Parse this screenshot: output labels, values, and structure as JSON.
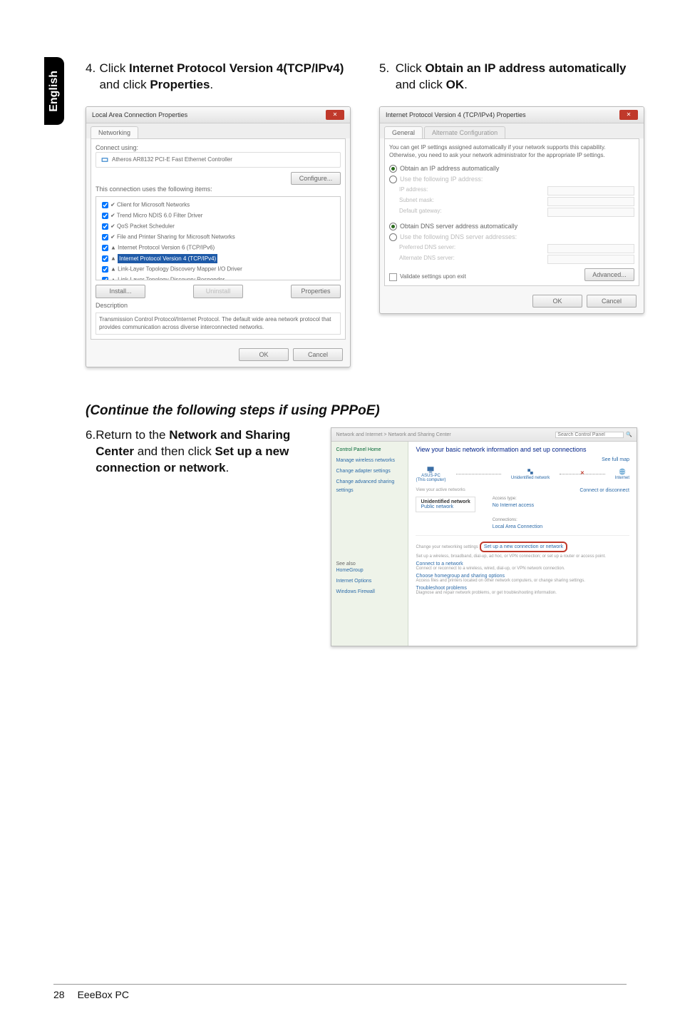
{
  "side_tab": "English",
  "chart_data": null,
  "step4": {
    "num": "4.",
    "text_pre": "Click ",
    "b1": "Internet Protocol Version 4(TCP/IPv4)",
    "text_mid": " and click ",
    "b2": "Properties",
    "text_end": ".",
    "dialog": {
      "title": "Local Area Connection Properties",
      "tab": "Networking",
      "connect_label": "Connect using:",
      "adapter": "Atheros AR8132 PCI-E Fast Ethernet Controller",
      "configure_btn": "Configure...",
      "uses_label": "This connection uses the following items:",
      "items": [
        "Client for Microsoft Networks",
        "Trend Micro NDIS 6.0 Filter Driver",
        "QoS Packet Scheduler",
        "File and Printer Sharing for Microsoft Networks",
        "Internet Protocol Version 6 (TCP/IPv6)",
        "Internet Protocol Version 4 (TCP/IPv4)",
        "Link-Layer Topology Discovery Mapper I/O Driver",
        "Link-Layer Topology Discovery Responder"
      ],
      "install_btn": "Install...",
      "uninstall_btn": "Uninstall",
      "properties_btn": "Properties",
      "desc_head": "Description",
      "desc_body": "Transmission Control Protocol/Internet Protocol. The default wide area network protocol that provides communication across diverse interconnected networks.",
      "ok": "OK",
      "cancel": "Cancel"
    }
  },
  "step5": {
    "num": "5.",
    "text_pre": "Click ",
    "b1": "Obtain an IP address automatically",
    "text_mid": " and click ",
    "b2": "OK",
    "text_end": ".",
    "dialog": {
      "title": "Internet Protocol Version 4 (TCP/IPv4) Properties",
      "tab1": "General",
      "tab2": "Alternate Configuration",
      "intro": "You can get IP settings assigned automatically if your network supports this capability. Otherwise, you need to ask your network administrator for the appropriate IP settings.",
      "r1": "Obtain an IP address automatically",
      "r2": "Use the following IP address:",
      "f1": "IP address:",
      "f2": "Subnet mask:",
      "f3": "Default gateway:",
      "r3": "Obtain DNS server address automatically",
      "r4": "Use the following DNS server addresses:",
      "f4": "Preferred DNS server:",
      "f5": "Alternate DNS server:",
      "validate": "Validate settings upon exit",
      "advanced": "Advanced...",
      "ok": "OK",
      "cancel": "Cancel"
    }
  },
  "pppoe_heading": "(Continue the following steps if using PPPoE)",
  "step6": {
    "num": "6.",
    "text_pre": "Return to the ",
    "b1": "Network and Sharing Center",
    "text_mid": " and then click ",
    "b2": "Set up a new connection or network",
    "text_end": "."
  },
  "ns": {
    "breadcrumb": "Network and Internet > Network and Sharing Center",
    "searchph": "Search Control Panel",
    "side": {
      "home": "Control Panel Home",
      "s1": "Manage wireless networks",
      "s2": "Change adapter settings",
      "s3": "Change advanced sharing settings",
      "seealso": "See also",
      "s4": "HomeGroup",
      "s5": "Internet Options",
      "s6": "Windows Firewall"
    },
    "main": {
      "heading": "View your basic network information and set up connections",
      "fullmap": "See full map",
      "node1": "ASUS-PC",
      "node1b": "(This computer)",
      "node2": "Unidentified network",
      "node3": "Internet",
      "active_label": "View your active networks",
      "conn_disc": "Connect or disconnect",
      "uni": "Unidentified network",
      "pub": "Public network",
      "accesstype": "Access type:",
      "accessval": "No Internet access",
      "conns": "Connections:",
      "connval": "Local Area Connection",
      "change_label": "Change your networking settings",
      "c1": "Set up a new connection or network",
      "c1d": "Set up a wireless, broadband, dial-up, ad hoc, or VPN connection; or set up a router or access point.",
      "c2": "Connect to a network",
      "c2d": "Connect or reconnect to a wireless, wired, dial-up, or VPN network connection.",
      "c3": "Choose homegroup and sharing options",
      "c3d": "Access files and printers located on other network computers, or change sharing settings.",
      "c4": "Troubleshoot problems",
      "c4d": "Diagnose and repair network problems, or get troubleshooting information."
    }
  },
  "footer": {
    "page": "28",
    "product": "EeeBox PC"
  }
}
